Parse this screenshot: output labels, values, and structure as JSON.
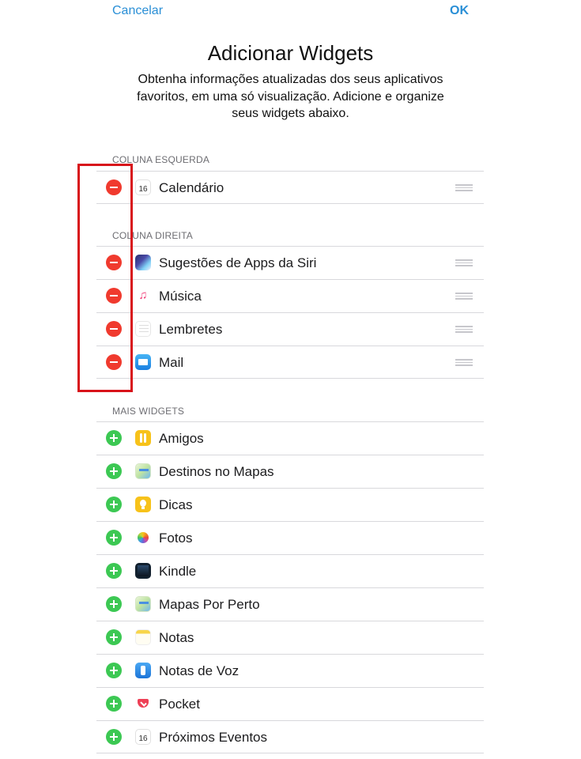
{
  "nav": {
    "cancel_label": "Cancelar",
    "ok_label": "OK"
  },
  "header": {
    "title": "Adicionar Widgets",
    "subtitle_lines": [
      "Obtenha informações atualizadas dos seus aplicativos",
      "favoritos, em uma só visualização. Adicione e organize",
      "seus widgets abaixo."
    ]
  },
  "sections": {
    "left_column": {
      "header": "COLUNA ESQUERDA",
      "items": [
        {
          "label": "Calendário",
          "icon": "calendar-icon",
          "icon_text": "16"
        }
      ]
    },
    "right_column": {
      "header": "COLUNA DIREITA",
      "items": [
        {
          "label": "Sugestões de Apps da Siri",
          "icon": "siri-suggestions-icon"
        },
        {
          "label": "Música",
          "icon": "music-icon",
          "icon_text": "♫"
        },
        {
          "label": "Lembretes",
          "icon": "reminders-icon"
        },
        {
          "label": "Mail",
          "icon": "mail-icon"
        }
      ]
    },
    "more_widgets": {
      "header": "MAIS WIDGETS",
      "items": [
        {
          "label": "Amigos",
          "icon": "friends-icon"
        },
        {
          "label": "Destinos no Mapas",
          "icon": "maps-icon"
        },
        {
          "label": "Dicas",
          "icon": "tips-icon"
        },
        {
          "label": "Fotos",
          "icon": "photos-icon"
        },
        {
          "label": "Kindle",
          "icon": "kindle-icon"
        },
        {
          "label": "Mapas Por Perto",
          "icon": "maps-icon"
        },
        {
          "label": "Notas",
          "icon": "notes-icon"
        },
        {
          "label": "Notas de Voz",
          "icon": "voice-memos-icon"
        },
        {
          "label": "Pocket",
          "icon": "pocket-icon"
        },
        {
          "label": "Próximos Eventos",
          "icon": "calendar-icon",
          "icon_text": "16"
        }
      ]
    }
  },
  "colors": {
    "accent": "#2a8fd6",
    "remove": "#f03a2e",
    "add": "#3cc853",
    "annotation_box": "#d8131a"
  }
}
